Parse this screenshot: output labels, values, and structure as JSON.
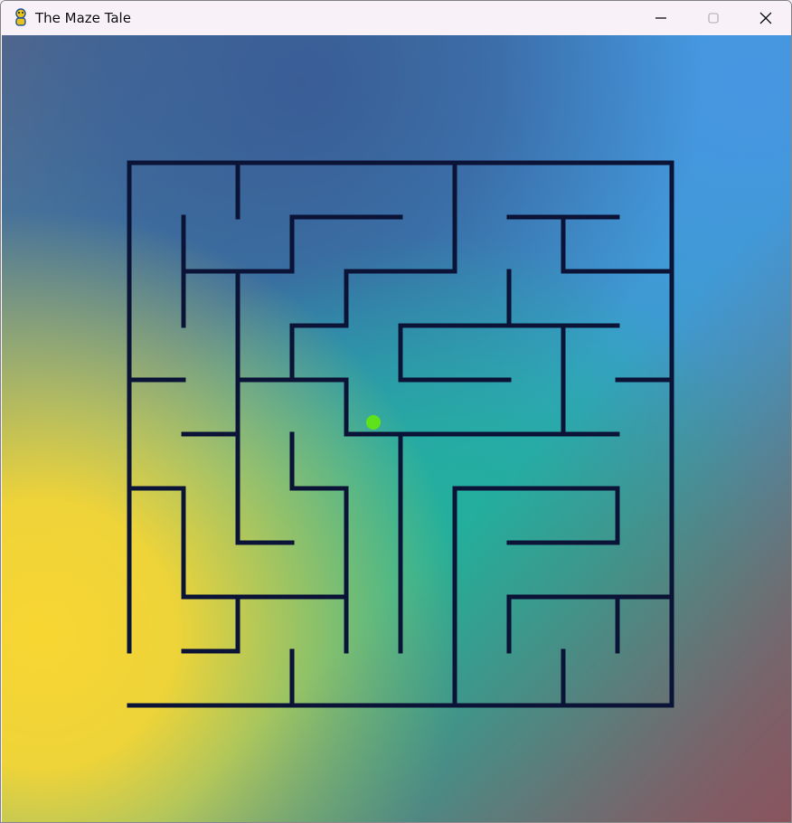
{
  "window": {
    "title": "The Maze Tale",
    "controls": [
      "minimize",
      "maximize",
      "close"
    ]
  },
  "icons": {
    "app": "python-icon",
    "minimize": "minimize-icon",
    "maximize": "maximize-icon",
    "close": "close-icon"
  },
  "colors": {
    "wall": "#0b1437",
    "player": "#5ee21a"
  },
  "maze": {
    "rows": 10,
    "cols": 10,
    "player": {
      "row": 4,
      "col": 4
    }
  }
}
